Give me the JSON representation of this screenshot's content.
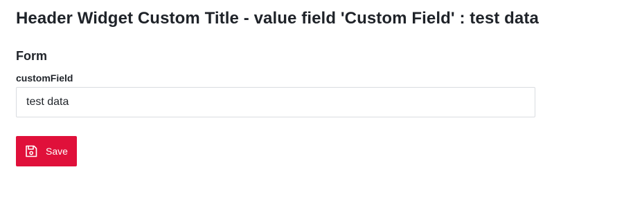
{
  "header": {
    "title": "Header Widget Custom Title - value field 'Custom Field' : test data"
  },
  "form": {
    "section_title": "Form",
    "custom_field": {
      "label": "customField",
      "value": "test data"
    },
    "save_button": {
      "label": "Save",
      "icon": "floppy-disk-icon",
      "color": "#e0103a"
    }
  }
}
